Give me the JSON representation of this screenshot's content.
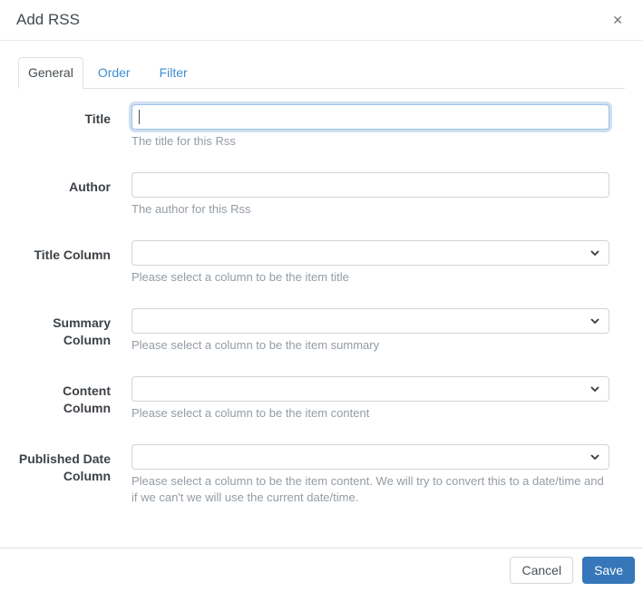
{
  "modal": {
    "title": "Add RSS",
    "close_icon": "✕"
  },
  "tabs": [
    {
      "label": "General",
      "active": true
    },
    {
      "label": "Order",
      "active": false
    },
    {
      "label": "Filter",
      "active": false
    }
  ],
  "form": {
    "fields": [
      {
        "label": "Title",
        "type": "text",
        "value": "",
        "placeholder": "",
        "focused": true,
        "help": "The title for this Rss"
      },
      {
        "label": "Author",
        "type": "text",
        "value": "",
        "placeholder": "",
        "focused": false,
        "help": "The author for this Rss"
      },
      {
        "label": "Title Column",
        "type": "select",
        "value": "",
        "help": "Please select a column to be the item title"
      },
      {
        "label": "Summary Column",
        "type": "select",
        "value": "",
        "help": "Please select a column to be the item summary"
      },
      {
        "label": "Content Column",
        "type": "select",
        "value": "",
        "help": "Please select a column to be the item content"
      },
      {
        "label": "Published Date Column",
        "type": "select",
        "value": "",
        "help": "Please select a column to be the item content. We will try to convert this to a date/time and if we can't we will use the current date/time."
      }
    ]
  },
  "footer": {
    "cancel_label": "Cancel",
    "save_label": "Save"
  },
  "colors": {
    "accent": "#3577b9",
    "link": "#3e8ed0",
    "focus_border": "#9cc3ea",
    "input_border": "#ced4da",
    "divider": "#dee2e6",
    "help_text": "#949ca4"
  }
}
